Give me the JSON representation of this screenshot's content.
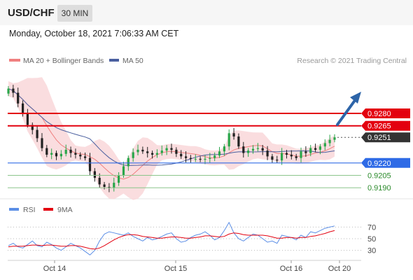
{
  "header": {
    "pair": "USD/CHF",
    "timeframe": "30 MIN"
  },
  "timestamp": "Monday, October 18, 2021 7:06:33 AM CET",
  "legend": {
    "ma20_label": "MA 20 + Bollinger Bands",
    "ma50_label": "MA 50",
    "copyright": "Research © 2021 Trading Central",
    "rsi_label": "RSI",
    "rsi_ma_label": "9MA"
  },
  "colors": {
    "up": "#2aa64a",
    "down": "#222222",
    "bands": "#f9d7d9",
    "ma20": "#f08080",
    "ma50": "#4a5f9f",
    "resistance": "#e3000f",
    "pivot": "#2f6be6",
    "support": "#8bc58b",
    "arrow": "#2d64a8",
    "last": "#333333",
    "rsi": "#5b8ee6",
    "rsi_ma": "#e3000f"
  },
  "chart_data": [
    {
      "type": "line",
      "description": "USD/CHF 30-minute candlestick price chart",
      "ylim": [
        0.918,
        0.933
      ],
      "x_ticks": [
        "Oct 14",
        "Oct 15",
        "Oct 16",
        "Oct 20"
      ],
      "series": [
        {
          "name": "Price (close, approx.)",
          "values": [
            0.931,
            0.9305,
            0.9292,
            0.928,
            0.9266,
            0.926,
            0.925,
            0.9238,
            0.923,
            0.9232,
            0.9228,
            0.9231,
            0.9236,
            0.9232,
            0.923,
            0.9228,
            0.9226,
            0.921,
            0.9202,
            0.9194,
            0.9191,
            0.919,
            0.9196,
            0.9205,
            0.9216,
            0.9226,
            0.9233,
            0.9236,
            0.9234,
            0.9232,
            0.923,
            0.9232,
            0.9235,
            0.9238,
            0.9236,
            0.9231,
            0.9228,
            0.9226,
            0.9225,
            0.9225,
            0.9224,
            0.9225,
            0.9226,
            0.9229,
            0.9234,
            0.924,
            0.9256,
            0.9252,
            0.924,
            0.9232,
            0.9235,
            0.9237,
            0.9238,
            0.9235,
            0.9228,
            0.9224,
            0.9223,
            0.9232,
            0.923,
            0.9228,
            0.9226,
            0.9234,
            0.9232,
            0.9238,
            0.9236,
            0.924,
            0.9244,
            0.9248,
            0.9251
          ]
        },
        {
          "name": "MA 20"
        },
        {
          "name": "MA 50"
        }
      ],
      "levels": [
        {
          "value": "0.9280",
          "kind": "resistance"
        },
        {
          "value": "0.9265",
          "kind": "resistance"
        },
        {
          "value": "0.9251",
          "kind": "last"
        },
        {
          "value": "0.9220",
          "kind": "pivot"
        },
        {
          "value": "0.9205",
          "kind": "support"
        },
        {
          "value": "0.9190",
          "kind": "support"
        }
      ]
    },
    {
      "type": "line",
      "description": "RSI panel",
      "ylim": [
        15,
        85
      ],
      "y_ticks": [
        "70",
        "50",
        "30"
      ],
      "series": [
        {
          "name": "RSI",
          "values": [
            38,
            42,
            36,
            34,
            40,
            46,
            38,
            36,
            44,
            40,
            34,
            30,
            36,
            42,
            38,
            34,
            28,
            22,
            30,
            46,
            58,
            62,
            60,
            58,
            56,
            60,
            54,
            50,
            46,
            52,
            48,
            50,
            54,
            58,
            60,
            50,
            44,
            46,
            52,
            56,
            58,
            62,
            56,
            48,
            52,
            64,
            78,
            60,
            50,
            46,
            52,
            58,
            56,
            50,
            44,
            46,
            42,
            56,
            54,
            52,
            48,
            56,
            52,
            62,
            60,
            64,
            68,
            70,
            72
          ]
        },
        {
          "name": "9MA",
          "values": [
            36,
            37,
            37,
            37,
            38,
            39,
            39,
            38,
            39,
            39,
            38,
            37,
            37,
            38,
            38,
            37,
            35,
            33,
            32,
            34,
            38,
            43,
            48,
            52,
            55,
            57,
            57,
            56,
            54,
            53,
            52,
            51,
            51,
            52,
            53,
            53,
            52,
            51,
            51,
            52,
            53,
            55,
            55,
            54,
            53,
            54,
            58,
            60,
            59,
            57,
            56,
            56,
            56,
            56,
            55,
            53,
            51,
            51,
            52,
            52,
            51,
            52,
            52,
            54,
            55,
            57,
            59,
            62,
            64
          ]
        }
      ]
    }
  ]
}
